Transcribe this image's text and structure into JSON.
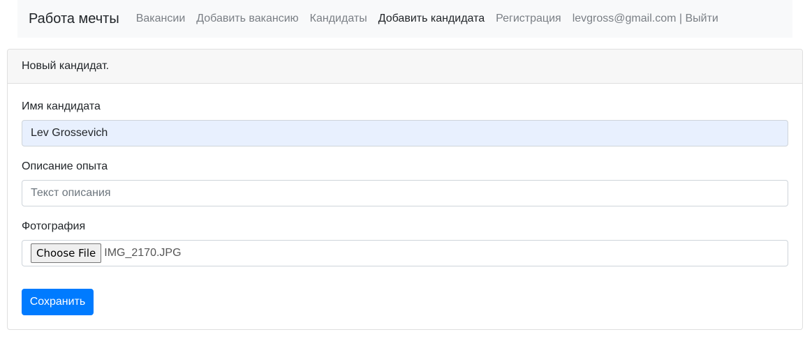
{
  "navbar": {
    "brand": "Работа мечты",
    "links": [
      {
        "label": "Вакансии"
      },
      {
        "label": "Добавить вакансию"
      },
      {
        "label": "Кандидаты"
      },
      {
        "label": "Добавить кандидата"
      },
      {
        "label": "Регистрация"
      }
    ],
    "user_text": "levgross@gmail.com | Выйти"
  },
  "card": {
    "header": "Новый кандидат.",
    "name_label": "Имя кандидата",
    "name_value": "Lev Grossevich",
    "description_label": "Описание опыта",
    "description_placeholder": "Текст описания",
    "photo_label": "Фотография",
    "file_button_label": "Choose File",
    "file_name": "IMG_2170.JPG",
    "save_label": "Сохранить"
  },
  "colors": {
    "navbar_bg": "#f8f9fa",
    "primary": "#007bff",
    "autofill_bg": "#e8f0fe"
  }
}
